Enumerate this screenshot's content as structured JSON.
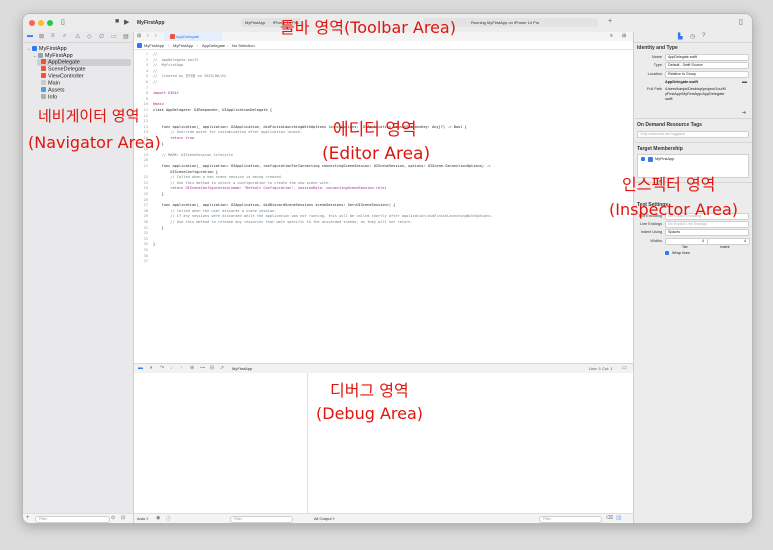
{
  "toolbar": {
    "project": "MyFirstApp",
    "scheme_tab": "MyFirstApp",
    "device_tab": "iPhone 14 Pro",
    "status": "Running MyFirstApp on iPhone 14 Pro"
  },
  "navigator": {
    "root": "MyFirstApp",
    "group": "MyFirstApp",
    "items": [
      "AppDelegate",
      "SceneDelegate",
      "ViewController",
      "Main",
      "Assets",
      "Info"
    ],
    "filter_placeholder": "Filter"
  },
  "editor": {
    "tab": "AppDelegate",
    "breadcrumb": [
      "MyFirstApp",
      "MyFirstApp",
      "AppDelegate",
      "No Selection"
    ],
    "code_lines": [
      {
        "n": "1",
        "t": "//"
      },
      {
        "n": "2",
        "t": "//  AppDelegate.swift"
      },
      {
        "n": "3",
        "t": "//  MyFirstApp"
      },
      {
        "n": "4",
        "t": "//"
      },
      {
        "n": "5",
        "t": "//  Created by 한지웅 on 2023/06/02."
      },
      {
        "n": "6",
        "t": "//"
      },
      {
        "n": "7",
        "t": ""
      },
      {
        "n": "8",
        "t": "import UIKit"
      },
      {
        "n": "9",
        "t": ""
      },
      {
        "n": "10",
        "t": "@main"
      },
      {
        "n": "11",
        "t": "class AppDelegate: UIResponder, UIApplicationDelegate {"
      },
      {
        "n": "12",
        "t": ""
      },
      {
        "n": "13",
        "t": ""
      },
      {
        "n": "14",
        "t": "    func application(_ application: UIApplication, didFinishLaunchingWithOptions launchOptions: [UIApplication.LaunchOptionsKey: Any]?) -> Bool {"
      },
      {
        "n": "15",
        "t": "        // Override point for customization after application launch."
      },
      {
        "n": "16",
        "t": "        return true"
      },
      {
        "n": "17",
        "t": "    }"
      },
      {
        "n": "18",
        "t": ""
      },
      {
        "n": "19",
        "t": "    // MARK: UISceneSession Lifecycle"
      },
      {
        "n": "20",
        "t": ""
      },
      {
        "n": "21",
        "t": "    func application(_ application: UIApplication, configurationForConnecting connectingSceneSession: UISceneSession, options: UIScene.ConnectionOptions) ->"
      },
      {
        "n": "",
        "t": "        UISceneConfiguration {"
      },
      {
        "n": "22",
        "t": "        // Called when a new scene session is being created."
      },
      {
        "n": "23",
        "t": "        // Use this method to select a configuration to create the new scene with."
      },
      {
        "n": "24",
        "t": "        return UISceneConfiguration(name: \"Default Configuration\", sessionRole: connectingSceneSession.role)"
      },
      {
        "n": "25",
        "t": "    }"
      },
      {
        "n": "26",
        "t": ""
      },
      {
        "n": "27",
        "t": "    func application(_ application: UIApplication, didDiscardSceneSessions sceneSessions: Set<UISceneSession>) {"
      },
      {
        "n": "28",
        "t": "        // Called when the user discards a scene session."
      },
      {
        "n": "29",
        "t": "        // If any sessions were discarded while the application was not running, this will be called shortly after application:didFinishLaunchingWithOptions."
      },
      {
        "n": "30",
        "t": "        // Use this method to release any resources that were specific to the discarded scenes, as they will not return."
      },
      {
        "n": "31",
        "t": "    }"
      },
      {
        "n": "32",
        "t": ""
      },
      {
        "n": "33",
        "t": ""
      },
      {
        "n": "34",
        "t": "}"
      },
      {
        "n": "35",
        "t": ""
      },
      {
        "n": "36",
        "t": ""
      },
      {
        "n": "37",
        "t": ""
      }
    ]
  },
  "debug": {
    "scheme": "MyFirstApp",
    "position": "Line: 1  Col: 1",
    "auto_label": "Auto ◊",
    "output_label": "All Output ◊",
    "filter_placeholder": "Filter"
  },
  "inspector": {
    "identity_title": "Identity and Type",
    "name_label": "Name",
    "name_value": "AppDelegate.swift",
    "type_label": "Type",
    "type_value": "Default - Swift Source",
    "location_label": "Location",
    "location_value": "Relative to Group",
    "file_name": "AppDelegate.swift",
    "fullpath_label": "Full Path",
    "fullpath_value": "/Users/hanjw/Desktop/project/Jou/MyFirstApp/MyFirstApp/AppDelegate.swift",
    "ondemand_title": "On Demand Resource Tags",
    "ondemand_placeholder": "Only resources are taggable",
    "target_title": "Target Membership",
    "target_item": "MyFirstApp",
    "text_settings_title": "Text Settings",
    "encoding_label": "Text Encoding",
    "encoding_value": "No Explicit Encoding",
    "line_endings_label": "Line Endings",
    "line_endings_value": "No Explicit Line Endings",
    "indent_label": "Indent Using",
    "indent_value": "Spaces",
    "widths_label": "Widths",
    "tab_value": "4",
    "indent_value_num": "4",
    "tab_caption": "Tab",
    "indent_caption": "Indent",
    "wrap_label": "Wrap lines"
  },
  "annotations": {
    "toolbar": "툴바 영역(Toolbar Area)",
    "navigator_ko": "네비게이터 영역",
    "navigator_en": "(Navigator Area)",
    "editor_ko": "에디터 영역",
    "editor_en": "(Editor Area)",
    "inspector_ko": "인스펙터 영역",
    "inspector_en": "(Inspector Area)",
    "debug_ko": "디버그 영역",
    "debug_en": "(Debug Area)"
  },
  "colors": {
    "accent": "#3478f6",
    "annotation": "#e0150e",
    "swift": "#f05138"
  }
}
